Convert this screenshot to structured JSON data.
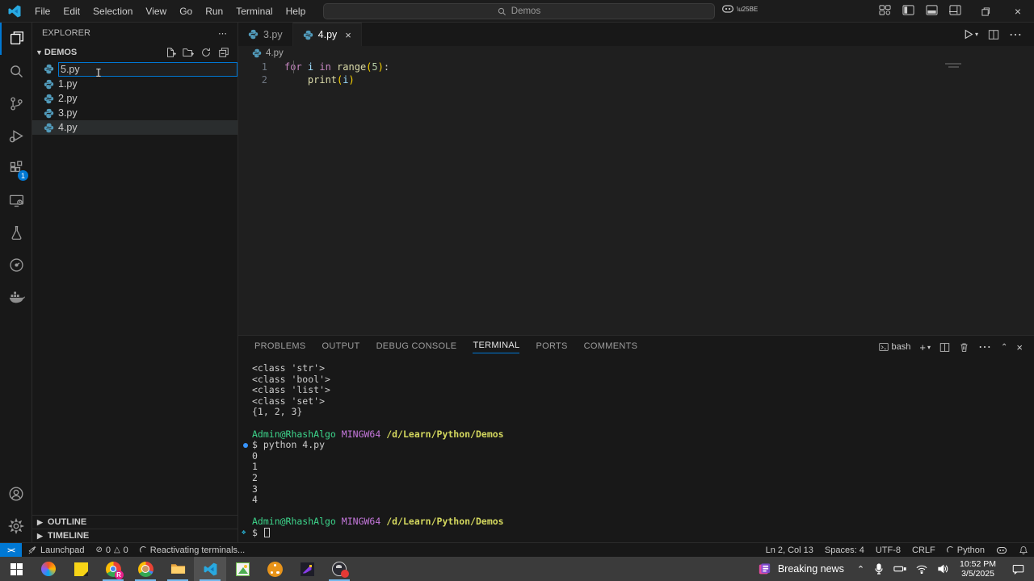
{
  "palette": {
    "accent_blue": "#0078d4",
    "python_icon": "#519aba",
    "terminal_green": "#3dd68c",
    "terminal_magenta": "#c678dd",
    "terminal_yellow": "#d3d75e",
    "command_decoration": "#3794ff",
    "taskbar_underline": "#76b9ed"
  },
  "title_bar": {
    "menus": [
      "File",
      "Edit",
      "Selection",
      "View",
      "Go",
      "Run",
      "Terminal",
      "Help"
    ],
    "back_arrow": "←",
    "forward_arrow": "→",
    "search_value": "Demos"
  },
  "activity_bar": {
    "extensions_badge": "1"
  },
  "sidebar": {
    "header": "EXPLORER",
    "header_more": "⋯",
    "folder": "DEMOS",
    "rename_value": "5.py",
    "files": [
      "1.py",
      "2.py",
      "3.py",
      "4.py"
    ],
    "outline_label": "OUTLINE",
    "timeline_label": "TIMELINE"
  },
  "editor": {
    "tabs": [
      "3.py",
      "4.py"
    ],
    "tab_close": "×",
    "breadcrumb": "4.py",
    "code": {
      "l1": {
        "n": "1",
        "kw1": "for ",
        "var1": "i",
        "kw2": " in ",
        "fn": "range",
        "p1": "(",
        "num": "5",
        "p2": ")",
        "end": ":"
      },
      "l2": {
        "n": "2",
        "indent": "    ",
        "fn": "print",
        "p1": "(",
        "var": "i",
        "p2": ")"
      }
    }
  },
  "panel": {
    "tabs": [
      "PROBLEMS",
      "OUTPUT",
      "DEBUG CONSOLE",
      "TERMINAL",
      "PORTS",
      "COMMENTS"
    ],
    "shell_label": "bash",
    "terminal": {
      "out1": [
        "<class 'str'>",
        "<class 'bool'>",
        "<class 'list'>",
        "<class 'set'>",
        "{1, 2, 3}"
      ],
      "prompt_user": "Admin@RhashAlgo",
      "prompt_host": "MINGW64",
      "prompt_path": "/d/Learn/Python/Demos",
      "command": "$ python 4.py",
      "out2": [
        "0",
        "1",
        "2",
        "3",
        "4"
      ],
      "prompt_char": "$"
    }
  },
  "status_bar": {
    "remote": "><",
    "launchpad": "Launchpad",
    "errors": "0",
    "warnings": "0",
    "activity": "Reactivating terminals...",
    "line_col": "Ln 2, Col 13",
    "spaces": "Spaces: 4",
    "encoding": "UTF-8",
    "eol": "CRLF",
    "language": "Python"
  },
  "taskbar": {
    "news_label": "Breaking news",
    "time": "10:52 PM",
    "date": "3/5/2025"
  }
}
